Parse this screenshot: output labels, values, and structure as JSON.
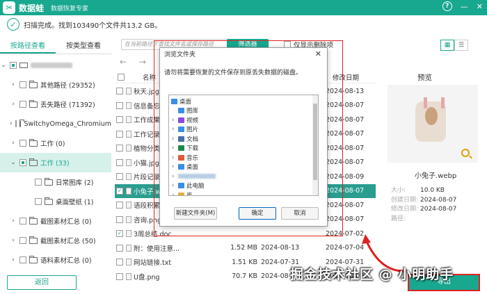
{
  "app": {
    "logo": "✂",
    "name": "数据蛙",
    "subtitle": "数据恢复专家"
  },
  "window": {
    "help": "?",
    "minimize": "—",
    "close": "✕"
  },
  "status": {
    "text": "扫描完成。找到103490个文件共13.2 GB。"
  },
  "tabs": {
    "by_path": "按路径查看",
    "by_type": "按类型查看"
  },
  "tree": [
    {
      "label": "其他路径 (29352)"
    },
    {
      "label": "丢失路径 (71392)"
    },
    {
      "label": "SwitchyOmega_Chromium"
    },
    {
      "label": "工作 (0)"
    },
    {
      "label": "工作 (33)"
    },
    {
      "label": "日常图库 (2)"
    },
    {
      "label": "桌面壁纸 (1)"
    },
    {
      "label": "截图素材汇总 (0)"
    },
    {
      "label": "截图素材汇总 (50)"
    },
    {
      "label": "语料素材汇总 (0)"
    }
  ],
  "back_button": "返回",
  "search": {
    "placeholder": "在当前路径下查找文件名或保存路径"
  },
  "filter_button": "筛选器",
  "deleted_only": "仅显示删除项",
  "columns": {
    "name": "名称",
    "date": "修改日期"
  },
  "files": [
    {
      "name": "秋天.jpg",
      "size": "",
      "type": "",
      "date": "2024-08-13"
    },
    {
      "name": "信息备忘.txt",
      "size": "",
      "type": "",
      "date": "2024-08-07"
    },
    {
      "name": "工作成果分.",
      "size": "",
      "type": "",
      "date": "2024-08-07"
    },
    {
      "name": "工作记录.so",
      "size": "",
      "type": "",
      "date": "2024-08-07"
    },
    {
      "name": "植物分类.d",
      "size": "",
      "type": "",
      "date": "2024-08-07"
    },
    {
      "name": "小猫.jpg",
      "size": "",
      "type": "",
      "date": "2024-08-07"
    },
    {
      "name": "片段记录.d",
      "size": "",
      "type": "",
      "date": "2024-08-09"
    },
    {
      "name": "小兔子.we",
      "size": "",
      "type": "",
      "date": "2024-08-07"
    },
    {
      "name": "语段积累.do",
      "size": "",
      "type": "",
      "date": "2024-08-07"
    },
    {
      "name": "咨询.png",
      "size": "",
      "type": "",
      "date": "2024-08-07"
    },
    {
      "name": "3周总结.doc",
      "size": "",
      "type": "",
      "date": "2024-07-02"
    },
    {
      "name": "附：使用注意...",
      "size": "1.52 MB",
      "type": "2024-08-13",
      "date": "2024-07-04"
    },
    {
      "name": "网站链接.txt",
      "size": "1.51 KB",
      "type": "2024-07-31",
      "date": "2024-07-31"
    },
    {
      "name": "U盘.png",
      "size": "70.7 KB",
      "type": "2024-08-07",
      "date": "2024-08-07"
    }
  ],
  "preview": {
    "title": "预览",
    "filename": "小兔子.webp",
    "meta": [
      {
        "k": "大小:",
        "v": "10.0 KB"
      },
      {
        "k": "创建日期:",
        "v": "2024-08-07"
      },
      {
        "k": "修改日期:",
        "v": "2024-08-07"
      },
      {
        "k": "路径:",
        "v": ""
      }
    ]
  },
  "export_button": "导出",
  "dialog": {
    "title": "浏览文件夹",
    "close": "✕",
    "message": "请勿将需要恢复的文件保存到原丢失数据的磁盘。",
    "items": [
      {
        "label": "桌面",
        "color": "#3a8ee6",
        "indent": 0
      },
      {
        "label": "图库",
        "color": "#3a8ee6",
        "indent": 1
      },
      {
        "label": "视频",
        "color": "#8a4be0",
        "indent": 1,
        "chev": "›"
      },
      {
        "label": "图片",
        "color": "#3a8ee6",
        "indent": 1,
        "chev": "›"
      },
      {
        "label": "文档",
        "color": "#4a6fa5",
        "indent": 1,
        "chev": "›"
      },
      {
        "label": "下载",
        "color": "#1a8a4a",
        "indent": 1,
        "chev": "›"
      },
      {
        "label": "音乐",
        "color": "#e05a3a",
        "indent": 1,
        "chev": "›"
      },
      {
        "label": "桌面",
        "color": "#3a8ee6",
        "indent": 1,
        "chev": "›"
      },
      {
        "label": "",
        "color": "#aac4e0",
        "indent": 1,
        "chev": "›"
      },
      {
        "label": "此电脑",
        "color": "#3a8ee6",
        "indent": 1,
        "chev": "›"
      },
      {
        "label": "库",
        "color": "#e0b040",
        "indent": 1,
        "chev": "›"
      }
    ],
    "new_folder": "新建文件夹(M)",
    "ok": "确定",
    "cancel": "取消"
  },
  "watermark": "掘金技术社区 @ 小明助手"
}
